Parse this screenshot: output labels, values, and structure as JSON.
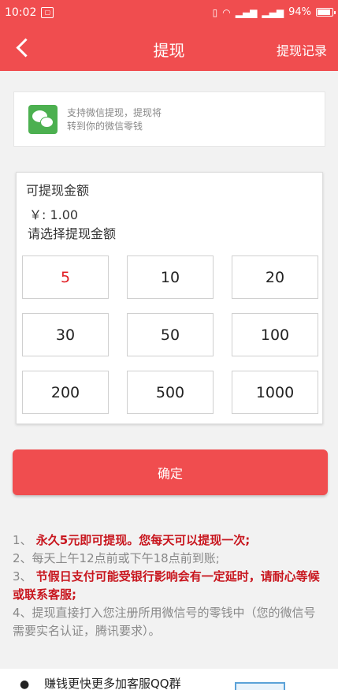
{
  "status_bar": {
    "time": "10:02",
    "battery": "94%",
    "battery_level": 0.94
  },
  "nav": {
    "title": "提现",
    "right_action": "提现记录"
  },
  "info": {
    "line1": "支持微信提现，提现将",
    "line2": "转到你的微信零钱",
    "icon": "wechat-icon"
  },
  "amount": {
    "available_label": "可提现金额",
    "balance": "￥:  1.00",
    "choose_label": "请选择提现金额",
    "options": [
      "5",
      "10",
      "20",
      "30",
      "50",
      "100",
      "200",
      "500",
      "1000"
    ],
    "selected": "5"
  },
  "confirm_label": "确定",
  "notes": {
    "n1_num": "1、",
    "n1_text": "永久5元即可提现。您每天可以提现一次;",
    "n2": "2、每天上午12点前或下午18点前到账;",
    "n3_num": "3、",
    "n3_text": "节假日支付可能受银行影响会有一定延时，请耐心等候或联系客服;",
    "n4": "4、提现直接打入您注册所用微信号的零钱中（您的微信号需要实名认证，腾讯要求）。"
  },
  "bottom": {
    "text": "赚钱更快更多加客服QQ群"
  },
  "colors": {
    "accent": "#f04d4f",
    "selected_text": "#e11e24",
    "warning_text": "#c8161e",
    "wechat": "#4cb050"
  }
}
